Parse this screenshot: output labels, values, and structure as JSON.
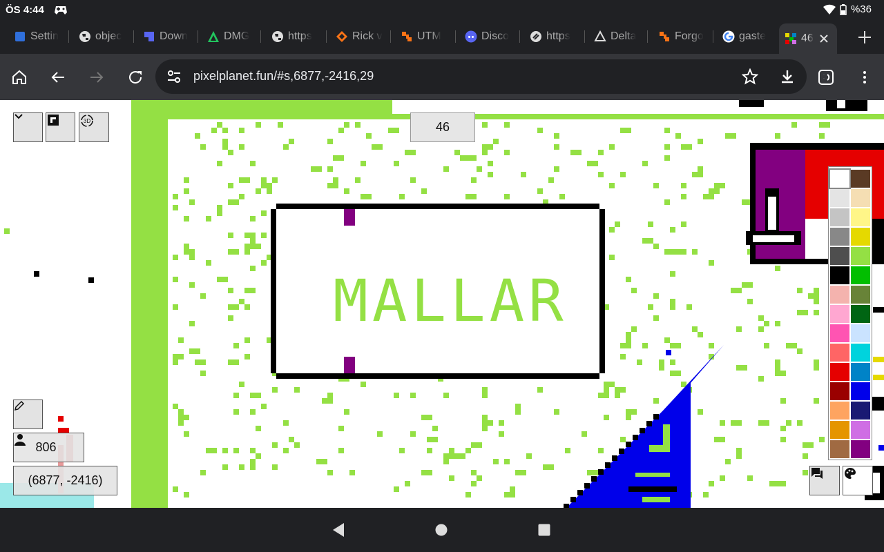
{
  "status": {
    "time": "ÖS 4:44",
    "battery": "%36"
  },
  "tabs": [
    {
      "label": "Settin",
      "icon": "settings-app-icon"
    },
    {
      "label": "objec",
      "icon": "globe-icon"
    },
    {
      "label": "Down",
      "icon": "download-site-icon"
    },
    {
      "label": "DMG",
      "icon": "dmg-site-icon"
    },
    {
      "label": "https",
      "icon": "globe-icon"
    },
    {
      "label": "Rick v",
      "icon": "rick-site-icon"
    },
    {
      "label": "UTM",
      "icon": "utm-site-icon"
    },
    {
      "label": "Disco",
      "icon": "discord-icon"
    },
    {
      "label": "https",
      "icon": "link-site-icon"
    },
    {
      "label": "Delta",
      "icon": "delta-site-icon"
    },
    {
      "label": "Forgo",
      "icon": "forgo-site-icon"
    },
    {
      "label": "gaste",
      "icon": "google-icon"
    },
    {
      "label": "46",
      "icon": "pixelplanet-icon"
    }
  ],
  "omnibox": {
    "url": "pixelplanet.fun/#s,6877,-2416,29"
  },
  "canvas": {
    "online_users_count": "46",
    "user_count": "806",
    "coordinates": "(6877, -2416)",
    "sign_text": "MALLAR"
  },
  "colors": {
    "green": "#94e044",
    "black": "#000000",
    "purple": "#820080",
    "blue": "#0000ea",
    "red": "#e50000",
    "cyan_strip": "#9be8e8"
  },
  "palette": [
    "#ffffff",
    "#5a3a24",
    "#e4e4e4",
    "#f5deb3",
    "#c4c4c4",
    "#fff688",
    "#888888",
    "#e5d900",
    "#4e4e4e",
    "#94e044",
    "#000000",
    "#02be01",
    "#f4b3ae",
    "#688338",
    "#ffa7d1",
    "#006513",
    "#ff54b2",
    "#cae3ff",
    "#ff6565",
    "#00d3dd",
    "#e50000",
    "#0083c7",
    "#9a0000",
    "#0000ea",
    "#fea460",
    "#191973",
    "#e59500",
    "#cf6ee4",
    "#a06a42",
    "#820080"
  ]
}
